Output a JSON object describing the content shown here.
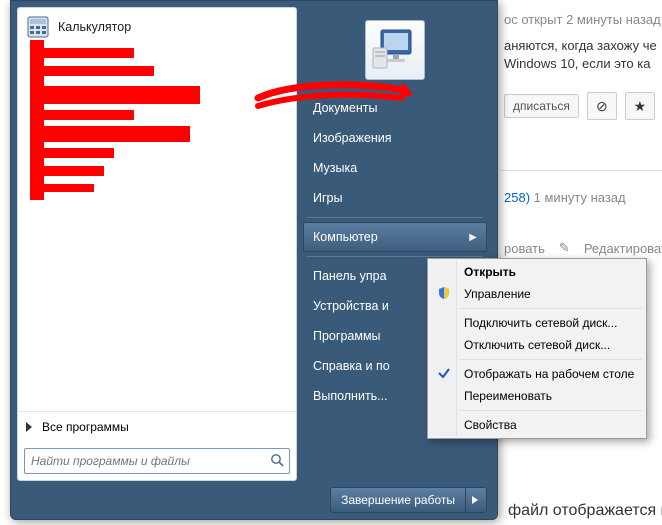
{
  "background": {
    "asked": "ос открыт 2 минуты назад",
    "line1": "аняются, когда захожу че",
    "line2": "Windows 10, если это ка",
    "subscribe": "дписаться",
    "answer_user_rep": "258)",
    "answer_time": "1 минуту назад",
    "comment": "ровать",
    "edit": "Редактировать",
    "snippet": "файл отображается к"
  },
  "start": {
    "programs": [
      {
        "label": "Калькулятор"
      }
    ],
    "all_programs": "Все программы",
    "search_placeholder": "Найти программы и файлы",
    "right_items": [
      {
        "label": "Документы"
      },
      {
        "label": "Изображения"
      },
      {
        "label": "Музыка"
      },
      {
        "label": "Игры"
      },
      {
        "sep": true
      },
      {
        "label": "Компьютер",
        "hover": true,
        "arrow": true
      },
      {
        "sep": true
      },
      {
        "label": "Панель упра"
      },
      {
        "label": "Устройства и"
      },
      {
        "label": "Программы"
      },
      {
        "label": "Справка и по"
      },
      {
        "label": "Выполнить..."
      }
    ],
    "shutdown": "Завершение работы"
  },
  "context_menu": [
    {
      "label": "Открыть",
      "bold": true
    },
    {
      "label": "Управление",
      "icon": "shield"
    },
    {
      "sep": true
    },
    {
      "label": "Подключить сетевой диск..."
    },
    {
      "label": "Отключить сетевой диск..."
    },
    {
      "sep": true
    },
    {
      "label": "Отображать на рабочем столе",
      "icon": "check"
    },
    {
      "label": "Переименовать"
    },
    {
      "sep": true
    },
    {
      "label": "Свойства"
    }
  ]
}
